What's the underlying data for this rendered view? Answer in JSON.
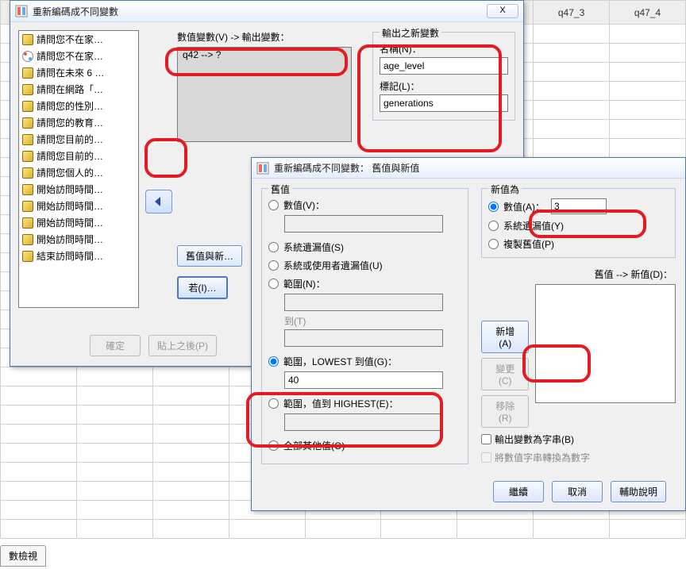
{
  "app_icon": "recode-icon",
  "bg_headers": [
    "q47_3",
    "q47_4"
  ],
  "dialog1": {
    "title": "重新編碼成不同變數",
    "label_numeric_out": "數值變數(V) -> 輸出變數：",
    "outbox_value": "q42 --> ?",
    "varlist": [
      {
        "icon": "ruler",
        "text": "請問您不在家…"
      },
      {
        "icon": "nominal",
        "text": "請問您不在家…"
      },
      {
        "icon": "ruler",
        "text": "請問在未來 6 …"
      },
      {
        "icon": "ruler",
        "text": "請問在網路「…"
      },
      {
        "icon": "ruler",
        "text": "請問您的性別…"
      },
      {
        "icon": "ruler",
        "text": "請問您的教育…"
      },
      {
        "icon": "ruler",
        "text": "請問您目前的…"
      },
      {
        "icon": "ruler",
        "text": "請問您目前的…"
      },
      {
        "icon": "ruler",
        "text": "請問您個人的…"
      },
      {
        "icon": "ruler",
        "text": "開始訪問時間…"
      },
      {
        "icon": "ruler",
        "text": "開始訪問時間…"
      },
      {
        "icon": "ruler",
        "text": "開始訪問時間…"
      },
      {
        "icon": "ruler",
        "text": "開始訪問時間…"
      },
      {
        "icon": "ruler",
        "text": "結束訪問時間…"
      }
    ],
    "output_group": {
      "legend": "輸出之新變數",
      "name_label": "名稱(N)：",
      "name_value": "age_level",
      "tag_label": "標記(L)：",
      "tag_value": "generations"
    },
    "old_new_btn": "舊值與新…",
    "if_btn": "若(I)…",
    "buttons": {
      "ok": "確定",
      "paste": "貼上之後(P)"
    }
  },
  "dialog2": {
    "title": "重新編碼成不同變數： 舊值與新值",
    "old_legend": "舊值",
    "new_legend": "新值為",
    "opt_value": "數值(V)：",
    "opt_sys": "系統遺漏值(S)",
    "opt_sys_user": "系統或使用者遺漏值(U)",
    "opt_range": "範圍(N)：",
    "opt_to": "到(T)",
    "opt_range_low": "範圍，LOWEST 到值(G)：",
    "low_value": "40",
    "opt_range_high": "範圍，值到 HIGHEST(E)：",
    "opt_other": "全部其他值(O)",
    "new_opt_value": "數值(A)：",
    "new_value": "3",
    "new_opt_sys": "系統遺漏值(Y)",
    "new_opt_copy": "複製舊值(P)",
    "oldnew_label": "舊值 --> 新值(D)：",
    "btn_add": "新增(A)",
    "btn_change": "變更(C)",
    "btn_remove": "移除(R)",
    "chk_output_str": "輸出變數為字串(B)",
    "chk_convert": "將數值字串轉換為數字",
    "buttons": {
      "continue": "繼續",
      "cancel": "取消",
      "help": "輔助說明"
    }
  },
  "bottom_tab": "數檢視"
}
